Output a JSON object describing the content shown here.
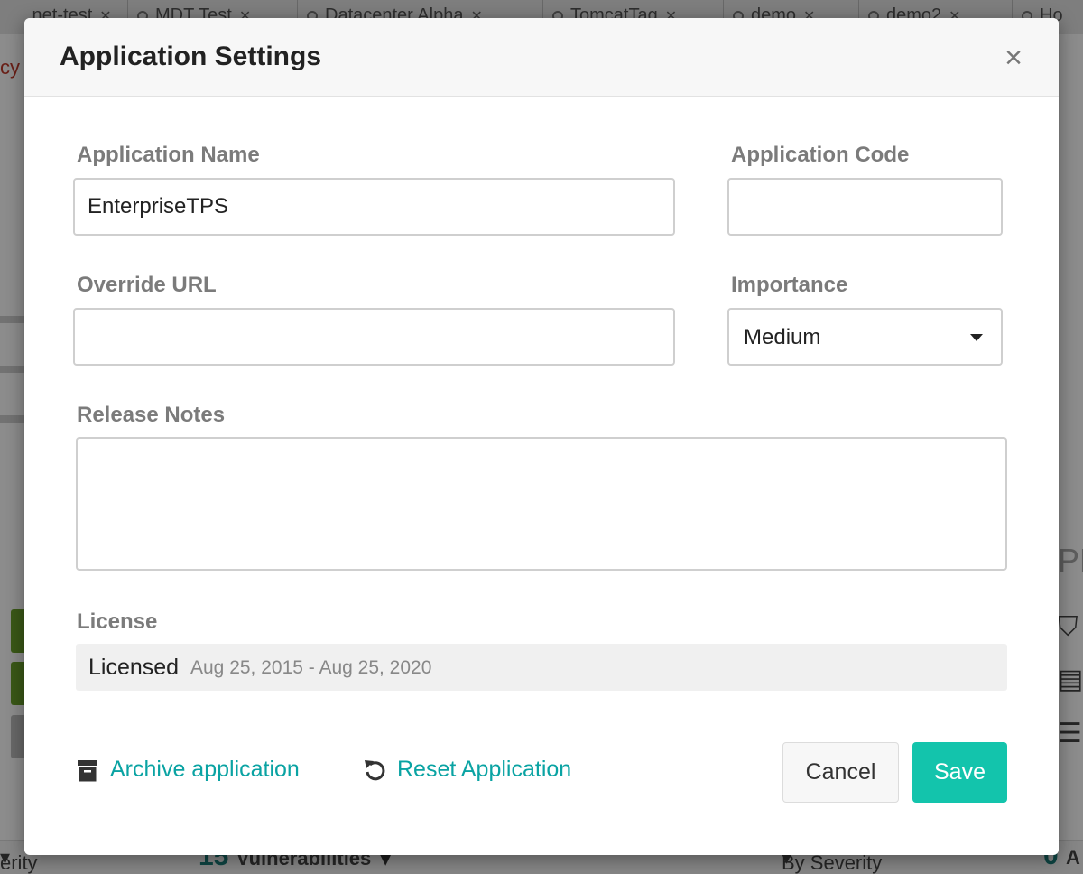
{
  "background": {
    "tabs": [
      ".net-test",
      "MDT Test",
      "Datacenter Alpha",
      "TomcatTag",
      "demo",
      "demo2",
      "Ho"
    ],
    "left_red_text": "cy V",
    "bottom": {
      "severity_left": "erity",
      "vulnerabilities_count": "15",
      "vulnerabilities_label": "Vulnerabilities",
      "by_severity": "By Severity",
      "right_count": "0",
      "right_initial": "A"
    },
    "right_edge_text": "PR"
  },
  "modal": {
    "title": "Application Settings",
    "close_icon": "close-icon",
    "fields": {
      "app_name": {
        "label": "Application Name",
        "value": "EnterpriseTPS",
        "placeholder": ""
      },
      "app_code": {
        "label": "Application Code",
        "value": "",
        "placeholder": ""
      },
      "override_url": {
        "label": "Override URL",
        "value": "",
        "placeholder": ""
      },
      "importance": {
        "label": "Importance",
        "selected": "Medium"
      },
      "release_notes": {
        "label": "Release Notes",
        "value": ""
      }
    },
    "license": {
      "label": "License",
      "status": "Licensed",
      "dates": "Aug 25, 2015 - Aug 25, 2020"
    },
    "actions": {
      "archive": {
        "label": "Archive application",
        "icon": "archive-icon"
      },
      "reset": {
        "label": "Reset Application",
        "icon": "reset-icon"
      },
      "cancel": "Cancel",
      "save": "Save"
    }
  },
  "colors": {
    "accent": "#0aa3a3",
    "save_button": "#13c4ac",
    "overlay": "rgba(0,0,0,0.45)"
  }
}
